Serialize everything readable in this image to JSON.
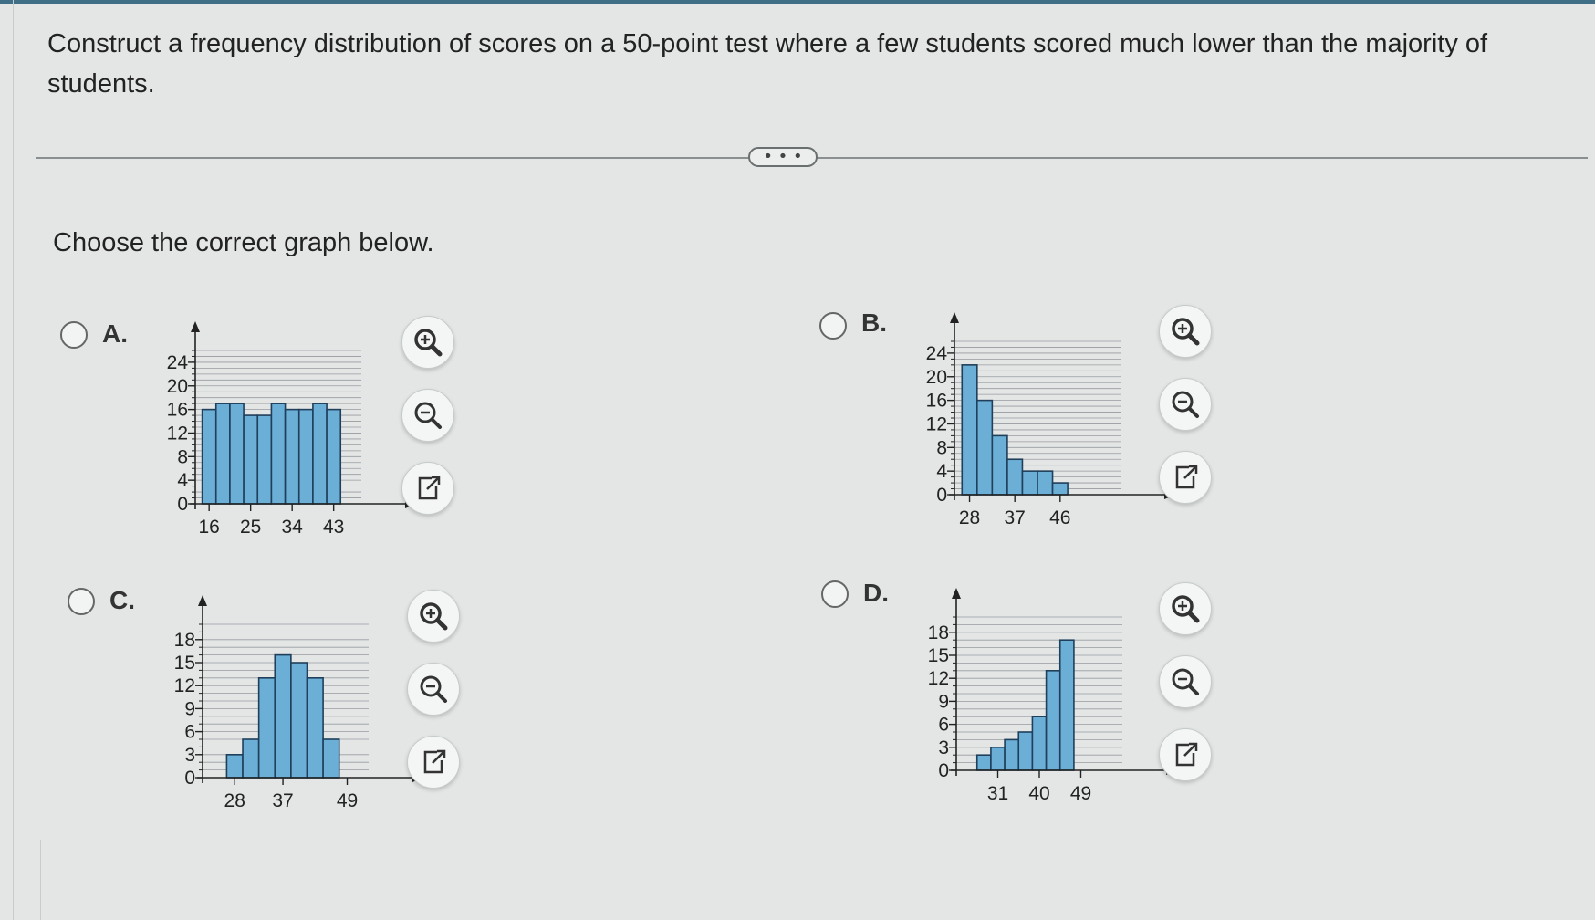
{
  "question": "Construct a frequency distribution of scores on a 50-point test where a few students scored much lower than the majority of students.",
  "more_button": "• • •",
  "prompt": "Choose the correct graph below.",
  "colors": {
    "bar_fill": "#6baed6",
    "bar_stroke": "#1f3f5a",
    "grid": "#8a8f93",
    "accent": "#3f6f86"
  },
  "tools": {
    "zoom_in": "zoom-in-icon",
    "zoom_out": "zoom-out-icon",
    "open": "external-link-icon"
  },
  "options": [
    {
      "letter": "A.",
      "chart_data": {
        "type": "bar",
        "x": [
          16,
          19,
          22,
          25,
          28,
          31,
          34,
          37,
          40,
          43,
          46
        ],
        "values": [
          16,
          17,
          17,
          15,
          15,
          17,
          16,
          16,
          17,
          16,
          0
        ],
        "bin_width": 3,
        "xlim": [
          13,
          49
        ],
        "ylim": [
          0,
          26
        ],
        "yticks": [
          0,
          4,
          8,
          12,
          16,
          20,
          24
        ],
        "yminor": 1,
        "xtick_labels": [
          16,
          25,
          34,
          43
        ],
        "xlabel": "",
        "ylabel": "",
        "grid": true
      }
    },
    {
      "letter": "B.",
      "chart_data": {
        "type": "bar",
        "x": [
          28,
          31,
          34,
          37,
          40,
          43,
          46
        ],
        "values": [
          22,
          16,
          10,
          6,
          4,
          4,
          2
        ],
        "bin_width": 3,
        "xlim": [
          25,
          58
        ],
        "ylim": [
          0,
          26
        ],
        "yticks": [
          0,
          4,
          8,
          12,
          16,
          20,
          24
        ],
        "yminor": 1,
        "xtick_labels": [
          28,
          37,
          46
        ],
        "xlabel": "",
        "ylabel": "",
        "grid": true
      }
    },
    {
      "letter": "C.",
      "chart_data": {
        "type": "bar",
        "x": [
          28,
          31,
          34,
          37,
          40,
          43,
          46
        ],
        "values": [
          3,
          5,
          13,
          16,
          15,
          13,
          5
        ],
        "bin_width": 3,
        "xlim": [
          22,
          53
        ],
        "ylim": [
          0,
          20
        ],
        "yticks": [
          0,
          3,
          6,
          9,
          12,
          15,
          18
        ],
        "yminor": 1,
        "xtick_labels": [
          28,
          37,
          49
        ],
        "xlabel": "",
        "ylabel": "",
        "grid": true
      }
    },
    {
      "letter": "D.",
      "chart_data": {
        "type": "bar",
        "x": [
          28,
          31,
          34,
          37,
          40,
          43,
          46
        ],
        "values": [
          2,
          3,
          4,
          5,
          7,
          13,
          17
        ],
        "bin_width": 3,
        "xlim": [
          22,
          58
        ],
        "ylim": [
          0,
          20
        ],
        "yticks": [
          0,
          3,
          6,
          9,
          12,
          15,
          18
        ],
        "yminor": 1,
        "xtick_labels": [
          31,
          40,
          49
        ],
        "xlabel": "",
        "ylabel": "",
        "grid": true
      }
    }
  ]
}
